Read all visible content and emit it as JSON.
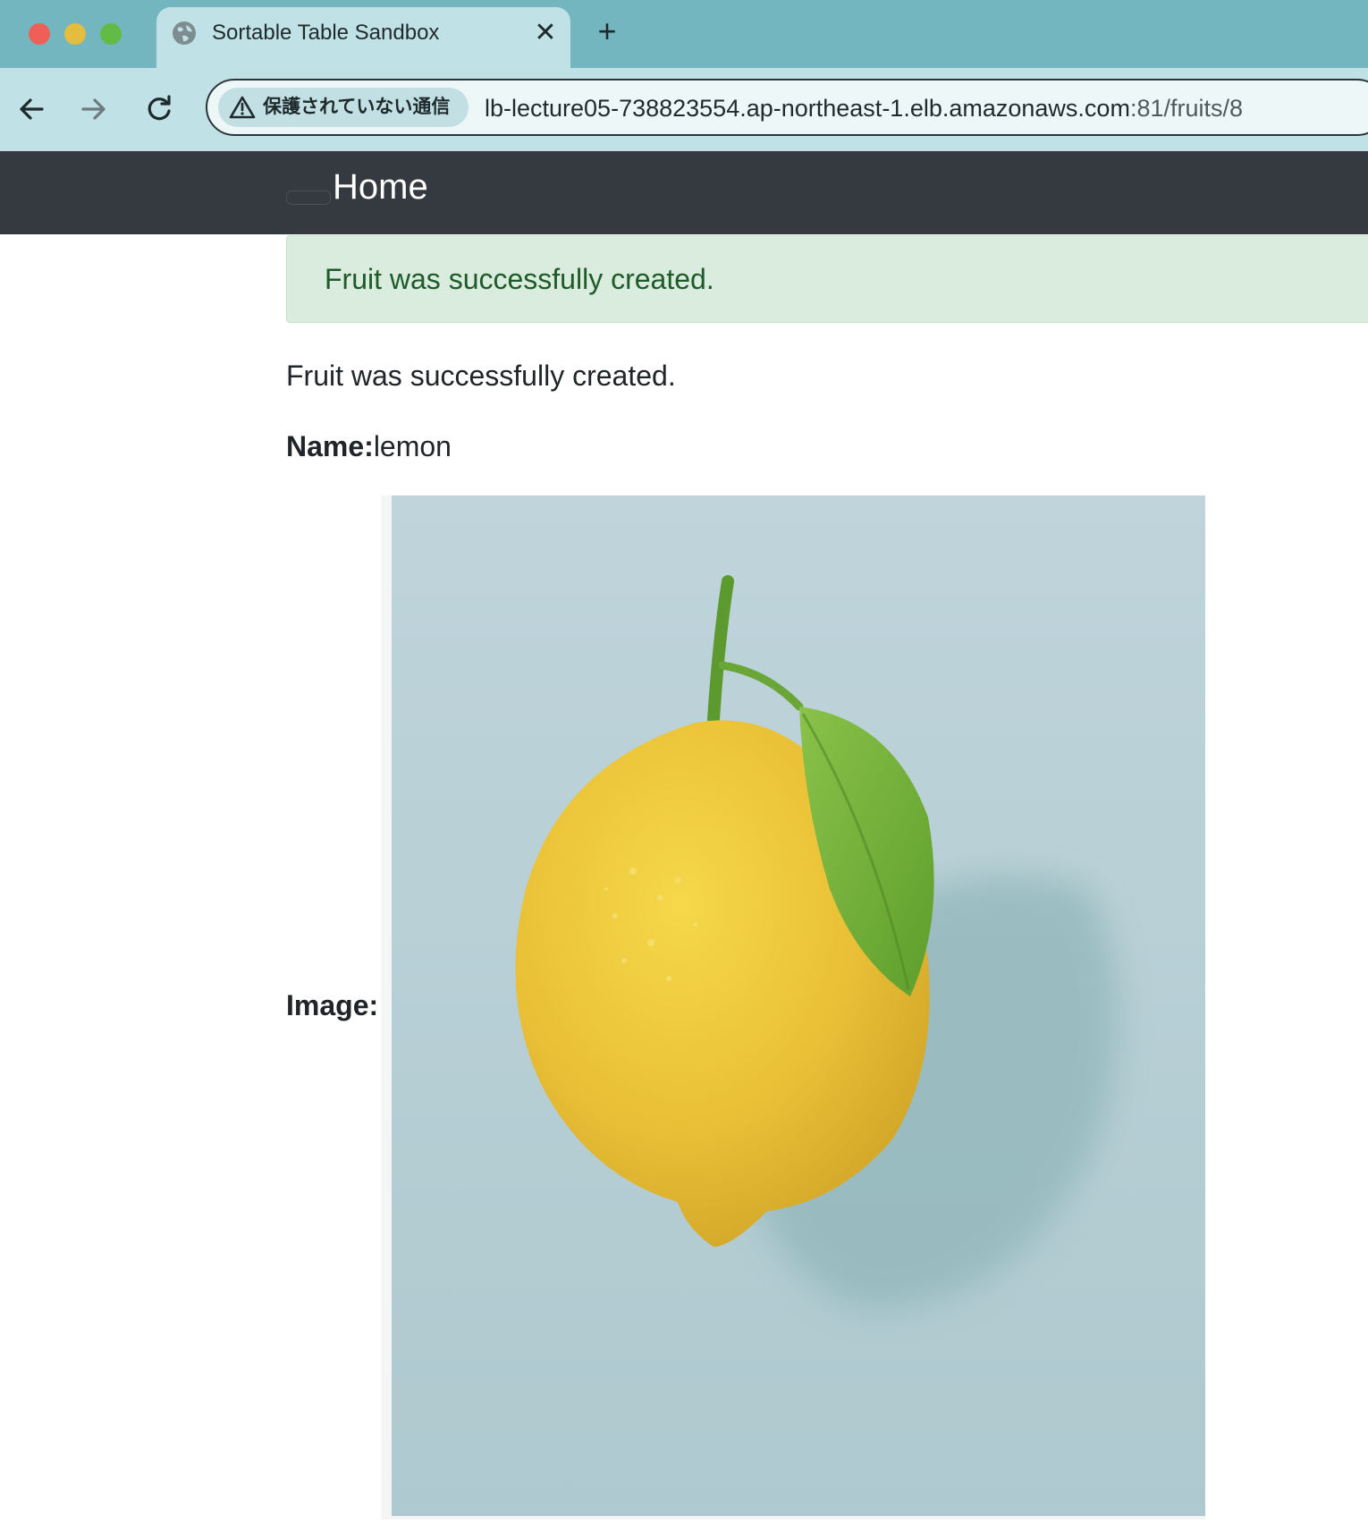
{
  "browser": {
    "tab": {
      "title": "Sortable Table Sandbox",
      "close_glyph": "✕",
      "favicon": "globe-icon"
    },
    "new_tab_glyph": "+",
    "security_label": "保護されていない通信",
    "url_host": "lb-lecture05-738823554.ap-northeast-1.elb.amazonaws.com",
    "url_path": ":81/fruits/8",
    "colors": {
      "tabbar": "#74b6c0",
      "toolbar": "#c0e1e5"
    }
  },
  "navbar": {
    "brand": "Home",
    "color": "#343a40"
  },
  "flash": {
    "message": "Fruit was successfully created.",
    "color": "#d9ecdd"
  },
  "notice": "Fruit was successfully created.",
  "fruit": {
    "name_label": "Name:",
    "name_value": "lemon",
    "image_label": "Image:"
  }
}
